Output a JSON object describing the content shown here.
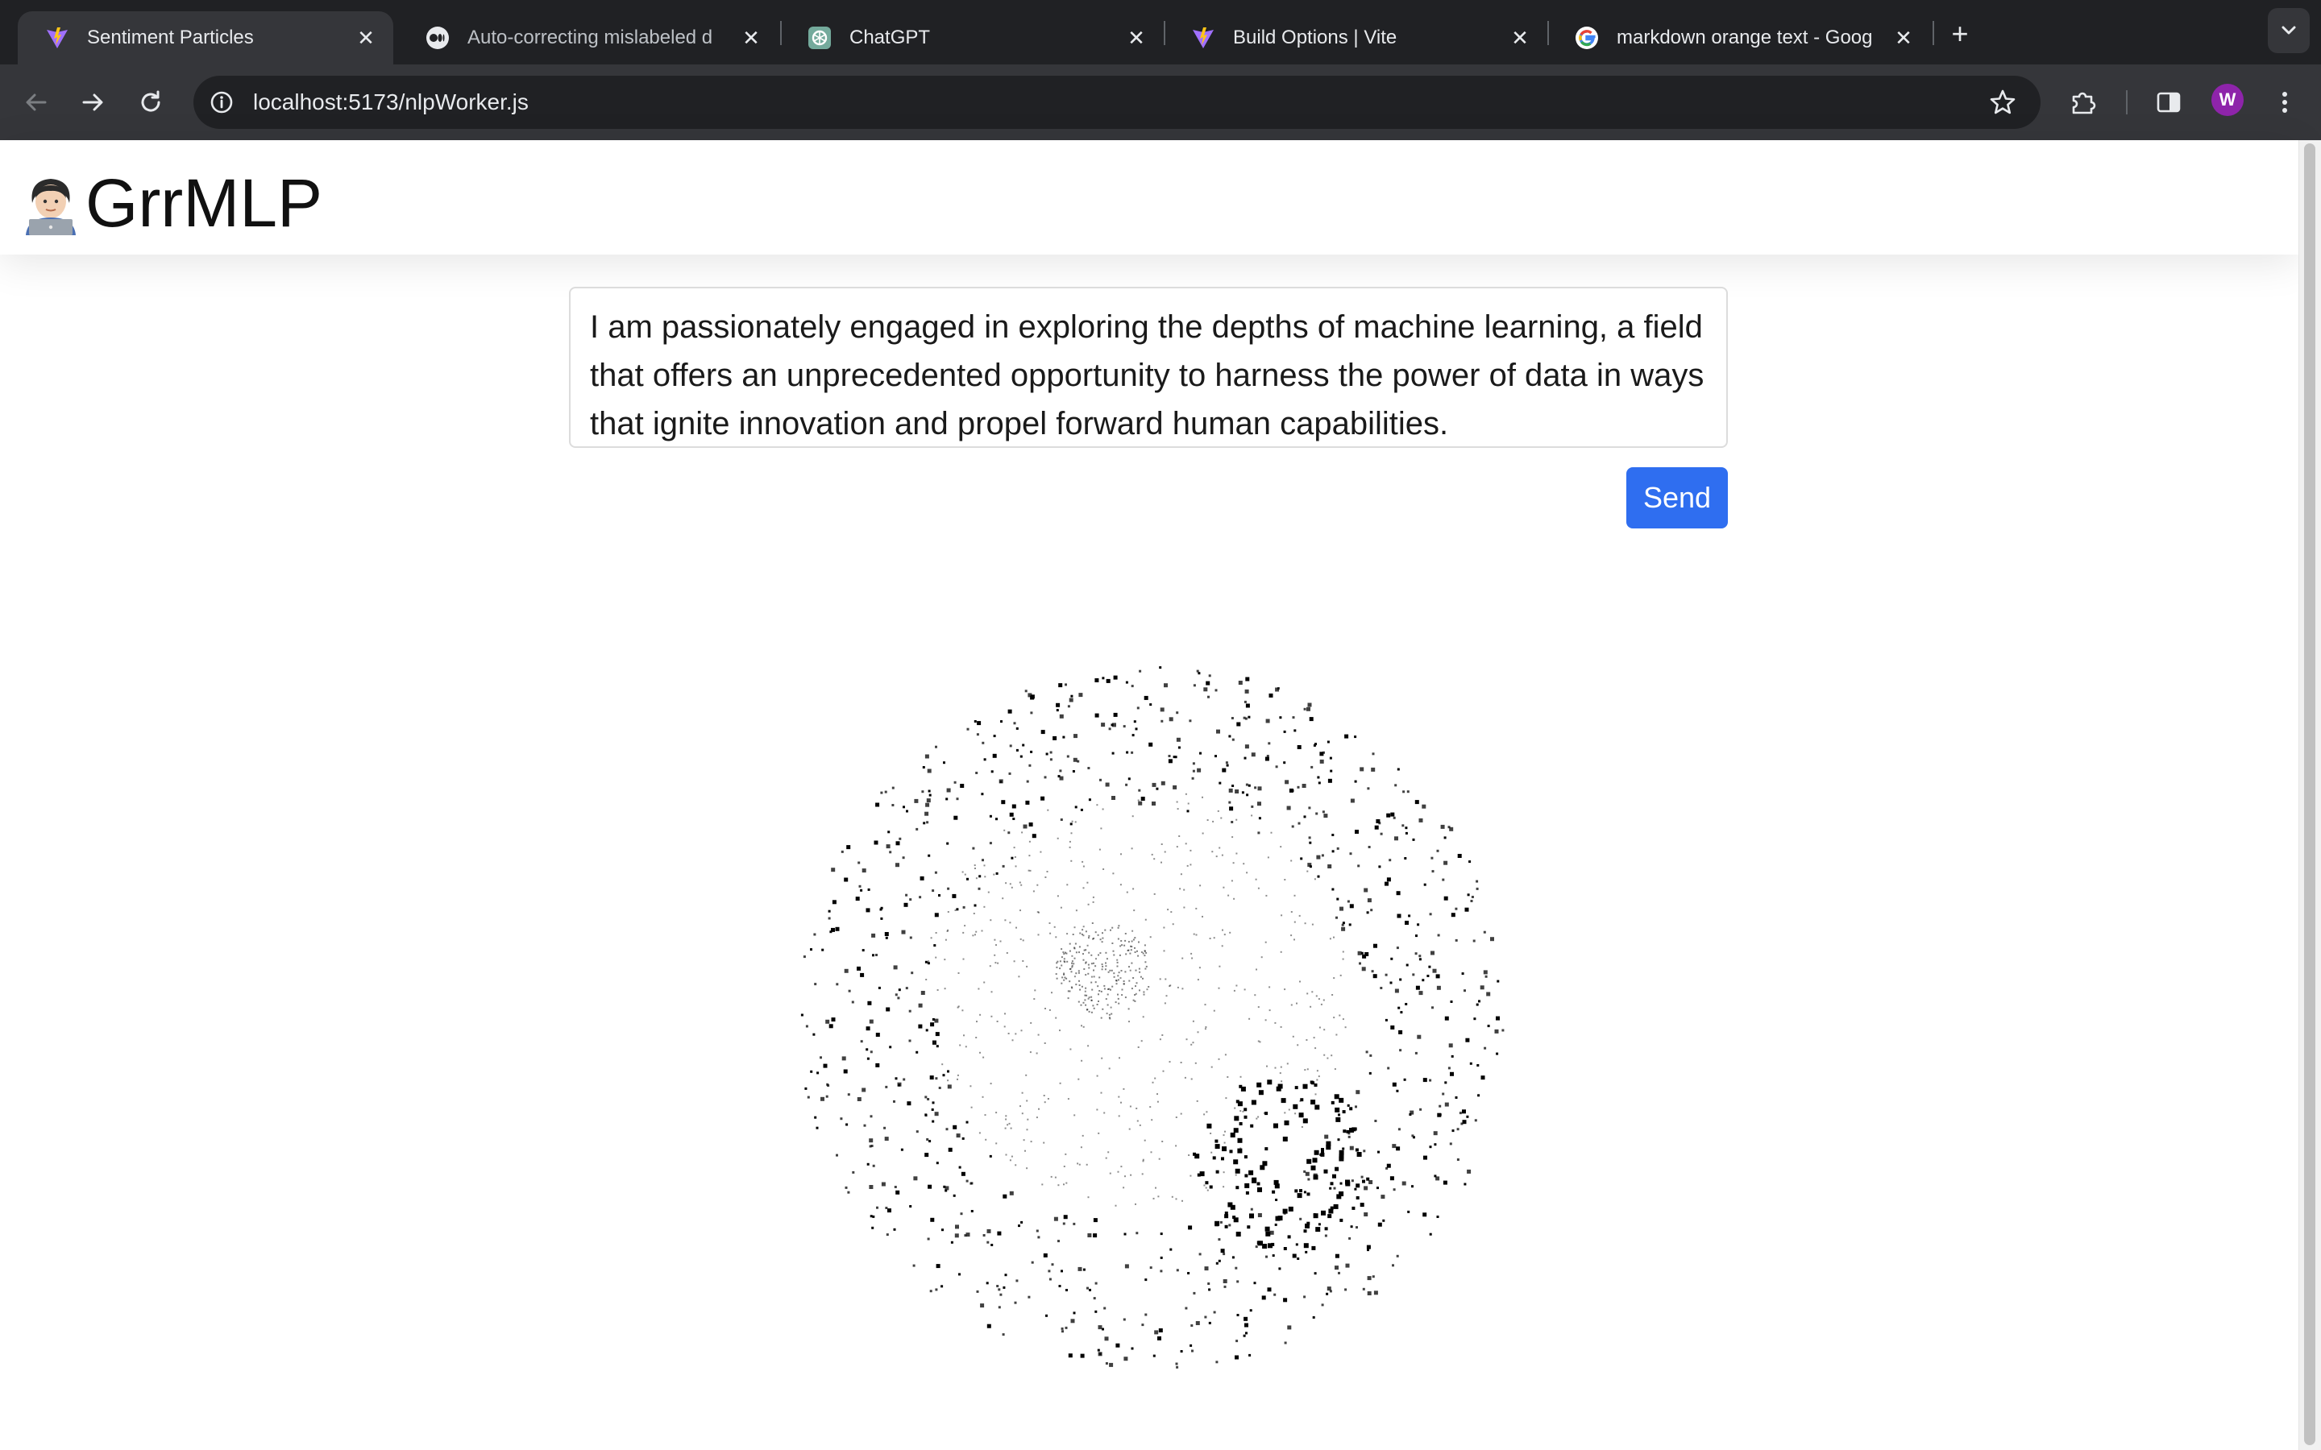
{
  "browser": {
    "tabs": [
      {
        "title": "Sentiment Particles",
        "favicon": "vite-logo-icon",
        "active": true
      },
      {
        "title": "Auto-correcting mislabeled d",
        "favicon": "medium-logo-icon",
        "active": false
      },
      {
        "title": "ChatGPT",
        "favicon": "chatgpt-logo-icon",
        "active": false
      },
      {
        "title": "Build Options | Vite",
        "favicon": "vite-logo-icon",
        "active": false
      },
      {
        "title": "markdown orange text - Goog",
        "favicon": "google-logo-icon",
        "active": false
      }
    ],
    "url": "localhost:5173/nlpWorker.js",
    "profile_initial": "W",
    "profile_color": "#8e24aa"
  },
  "app": {
    "brand_emoji": "technologist-emoji-icon",
    "brand_name": "GrrMLP",
    "input_text": "I am passionately engaged in exploring the depths of machine learning, a field that offers an unprecedented opportunity to harness the power of data in ways that ignite innovation and propel forward human capabilities.",
    "send_label": "Send",
    "accent_color": "#2f6ef0"
  }
}
